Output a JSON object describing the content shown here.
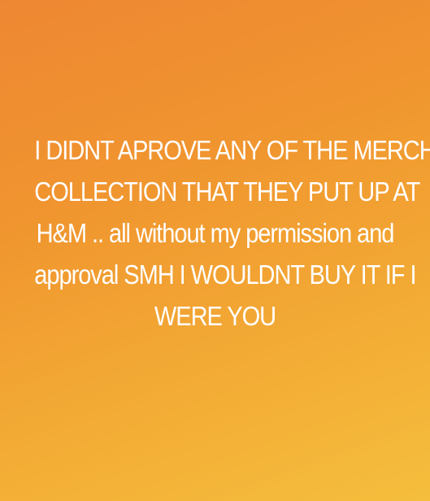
{
  "story": {
    "background_colors": [
      "#ee8733",
      "#f0952f",
      "#f3ac35",
      "#f5be3d"
    ],
    "text_color": "#ffffff",
    "lines": [
      "I DIDNT APROVE ANY OF THE MERCH",
      "COLLECTION THAT THEY PUT UP AT",
      "H&M .. all without my permission and",
      "approval SMH I WOULDNT BUY IT IF I",
      "WERE YOU"
    ]
  }
}
